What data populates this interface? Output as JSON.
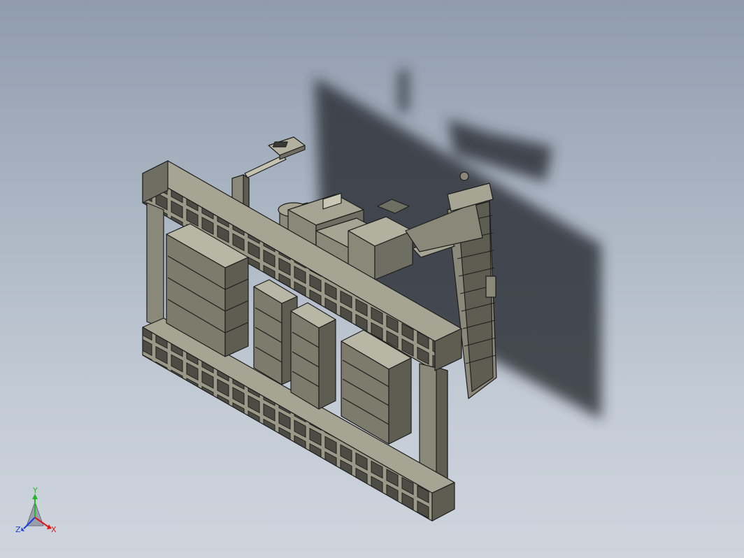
{
  "viewport": {
    "colors": {
      "background_top": "#8f9cae",
      "background_bottom": "#cfd5dd",
      "model_face": "#8a8878",
      "model_top": "#a6a492",
      "model_dark": "#5e5d52",
      "edge": "#1e1e1e",
      "shadow": "#2b2f36"
    }
  },
  "triad": {
    "x_label": "X",
    "y_label": "Y",
    "z_label": "Z",
    "colors": {
      "x": "#e0151b",
      "y": "#22b82a",
      "z": "#1d3fe0"
    }
  }
}
